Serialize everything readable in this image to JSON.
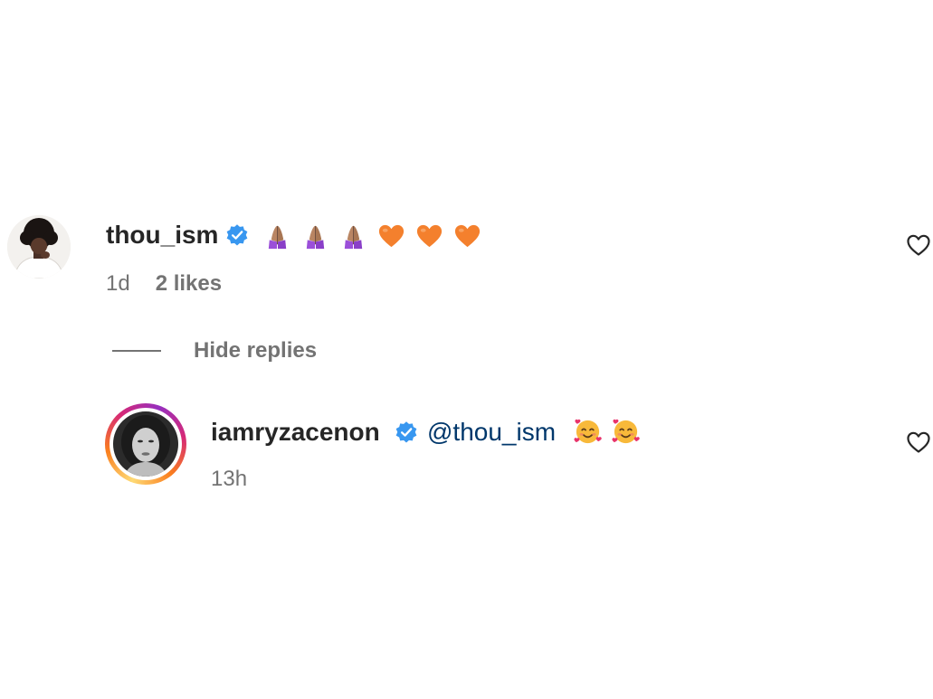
{
  "comment": {
    "username": "thou_ism",
    "verified": true,
    "emojis": [
      "folded-hands-medium-skin-icon",
      "folded-hands-medium-skin-icon",
      "folded-hands-medium-skin-icon",
      "orange-heart-icon",
      "orange-heart-icon",
      "orange-heart-icon"
    ],
    "time": "1d",
    "likes": "2 likes"
  },
  "replies_toggle": {
    "label": "Hide replies"
  },
  "reply": {
    "username": "iamryzacenon",
    "verified": true,
    "mention": "@thou_ism",
    "emojis": [
      "smiling-face-with-hearts-icon",
      "smiling-face-with-hearts-icon"
    ],
    "time": "13h"
  },
  "colors": {
    "username": "#262626",
    "meta": "#737373",
    "mention": "#00376b",
    "verified": "#0095f6",
    "orange_heart": "#f4802d",
    "folded_hands_sleeve": "#9b4fd9",
    "background": "#ffffff"
  }
}
